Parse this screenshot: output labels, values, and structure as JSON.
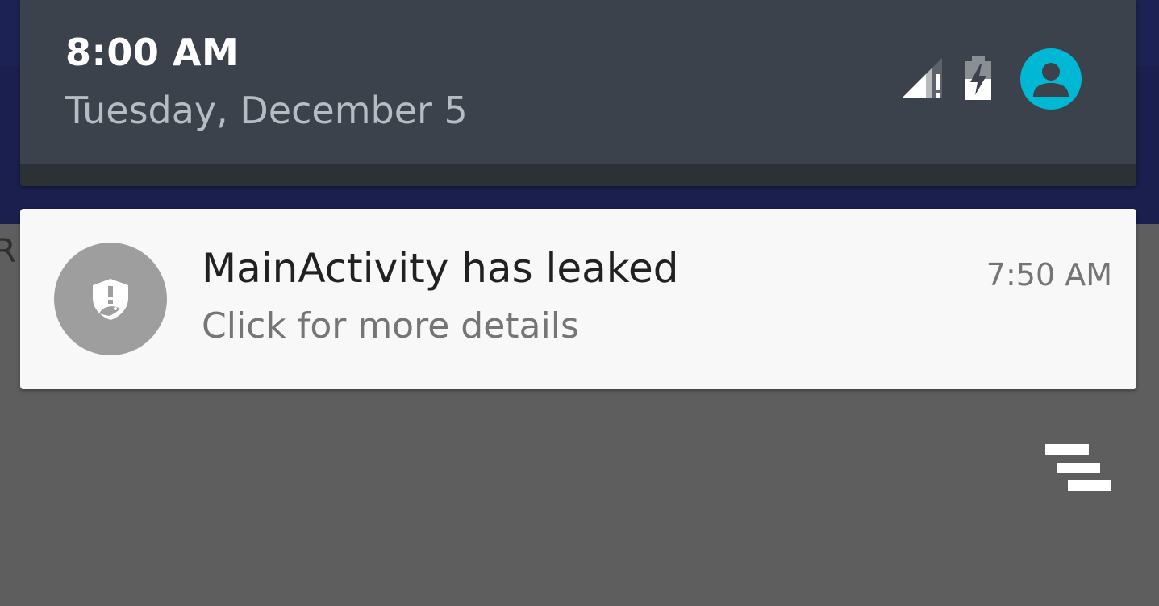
{
  "status_header": {
    "time": "8:00 AM",
    "date": "Tuesday, December 5",
    "icons": [
      "signal-no-data-icon",
      "battery-charging-icon",
      "user-avatar-icon"
    ],
    "avatar_color": "#00b8d4"
  },
  "background_app": {
    "partial_text": "R",
    "toolbar_color": "#1b1f4e"
  },
  "notification": {
    "app_icon": "leak-canary-shield-icon",
    "title": "MainActivity has leaked",
    "text": "Click for more details",
    "time": "7:50 AM"
  },
  "clear_all": {
    "icon": "clear-all-icon"
  }
}
